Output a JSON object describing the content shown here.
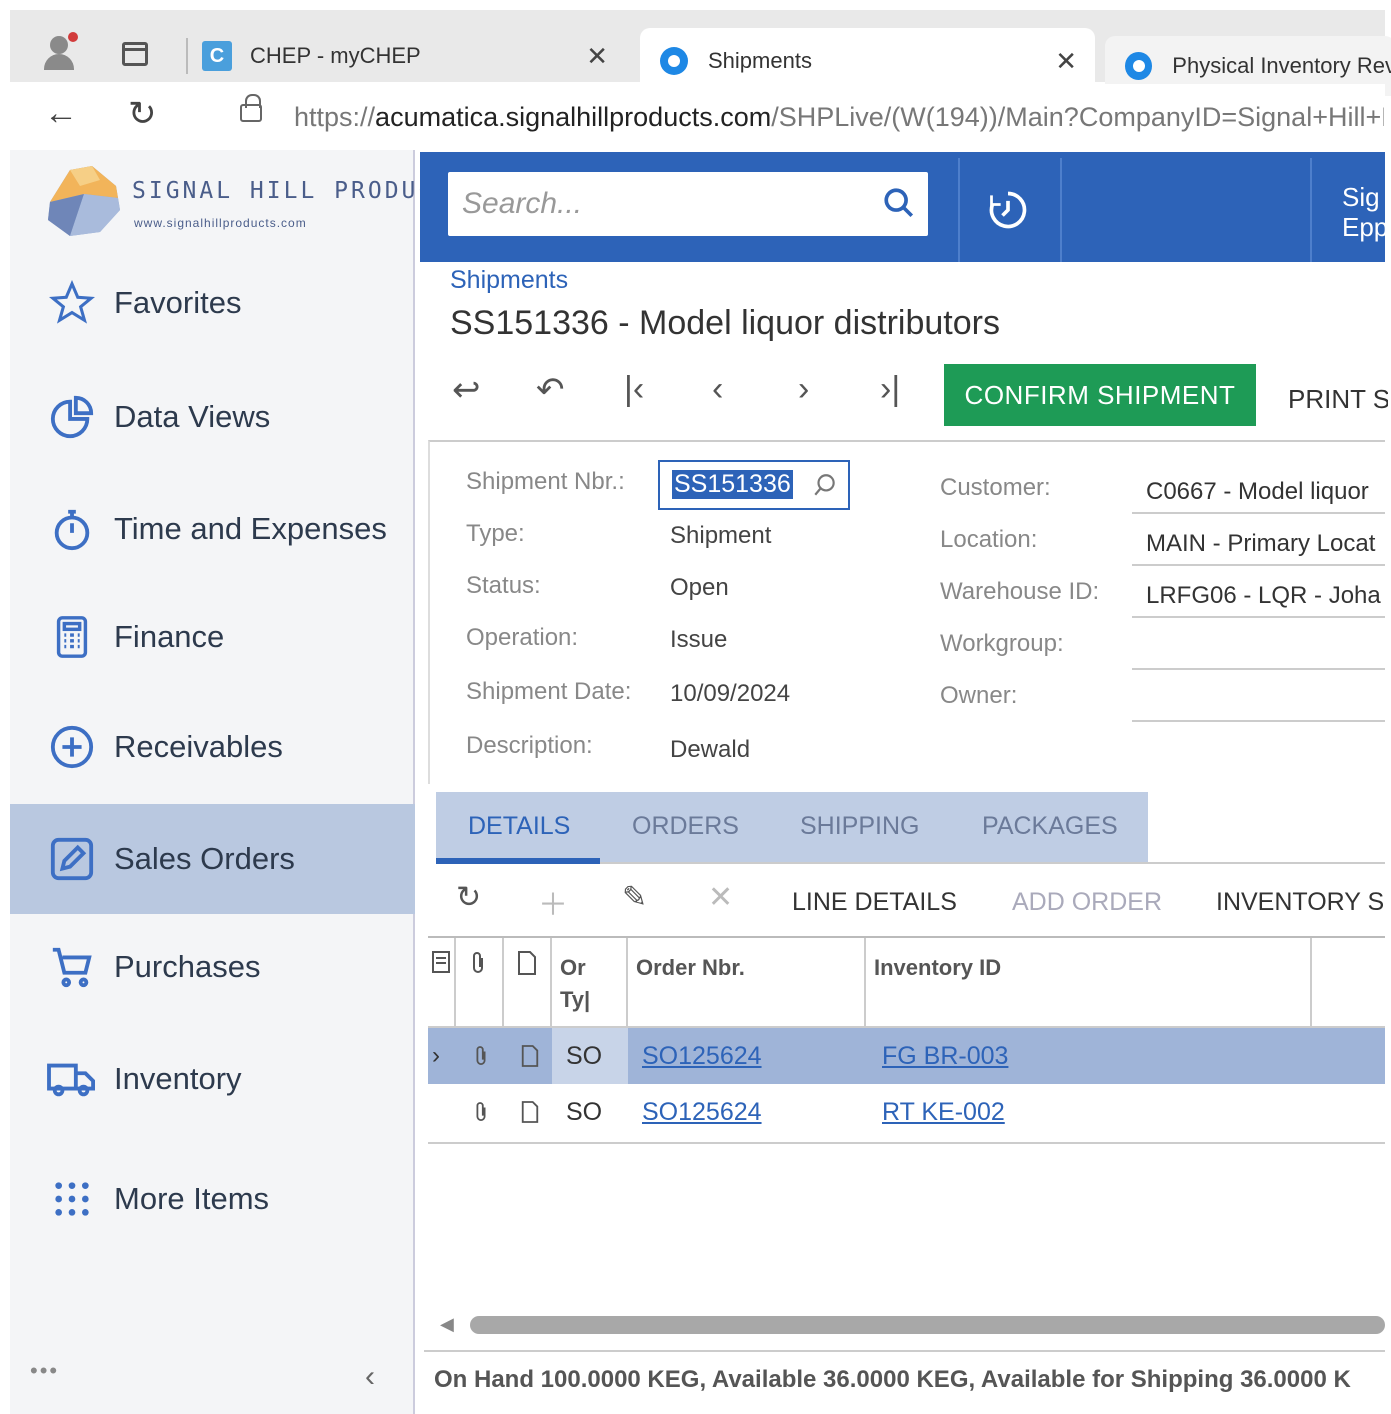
{
  "browser": {
    "tabs": [
      {
        "title": "CHEP - myCHEP"
      },
      {
        "title": "Shipments"
      },
      {
        "title": "Physical Inventory Revi"
      }
    ],
    "url_host": "https://",
    "url_domain": "acumatica.signalhillproducts.com",
    "url_path": "/SHPLive/(W(194))/Main?CompanyID=Signal+Hill+P"
  },
  "brand": {
    "name": "SIGNAL HILL PRODUCTS",
    "url": "www.signalhillproducts.com"
  },
  "sidebar": {
    "items": [
      {
        "label": "Favorites",
        "icon": "star-icon"
      },
      {
        "label": "Data Views",
        "icon": "pie-chart-icon"
      },
      {
        "label": "Time and Expenses",
        "icon": "stopwatch-icon"
      },
      {
        "label": "Finance",
        "icon": "calculator-icon"
      },
      {
        "label": "Receivables",
        "icon": "plus-circle-icon"
      },
      {
        "label": "Sales Orders",
        "icon": "edit-icon"
      },
      {
        "label": "Purchases",
        "icon": "cart-icon"
      },
      {
        "label": "Inventory",
        "icon": "truck-icon"
      },
      {
        "label": "More Items",
        "icon": "grid-dots-icon"
      }
    ],
    "more": "•••",
    "collapse": "‹"
  },
  "appbar": {
    "search_placeholder": "Search...",
    "user_line1": "Sig",
    "user_line2": "Epp"
  },
  "form": {
    "breadcrumb": "Shipments",
    "title": "SS151336 - Model liquor distributors",
    "confirm_label": "CONFIRM SHIPMENT",
    "print_label": "PRINT S",
    "labels": {
      "shipment_nbr": "Shipment Nbr.:",
      "type": "Type:",
      "status": "Status:",
      "operation": "Operation:",
      "shipment_date": "Shipment Date:",
      "description": "Description:",
      "customer": "Customer:",
      "location": "Location:",
      "warehouse": "Warehouse ID:",
      "workgroup": "Workgroup:",
      "owner": "Owner:"
    },
    "values": {
      "shipment_nbr": "SS151336",
      "type": "Shipment",
      "status": "Open",
      "operation": "Issue",
      "shipment_date": "10/09/2024",
      "description": "Dewald",
      "customer": "C0667 - Model liquor",
      "location": "MAIN - Primary Locat",
      "warehouse": "LRFG06 - LQR - Joha",
      "workgroup": "",
      "owner": ""
    }
  },
  "tabs": [
    "DETAILS",
    "ORDERS",
    "SHIPPING",
    "PACKAGES"
  ],
  "grid_toolbar": {
    "line_details": "LINE DETAILS",
    "add_order": "ADD ORDER",
    "inventory": "INVENTORY S"
  },
  "grid": {
    "headers": {
      "order_type": "Or Ty|",
      "order_nbr": "Order Nbr.",
      "inventory_id": "Inventory ID"
    },
    "rows": [
      {
        "type": "SO",
        "order_nbr": "SO125624",
        "inventory_id": "FG BR-003"
      },
      {
        "type": "SO",
        "order_nbr": "SO125624",
        "inventory_id": "RT KE-002"
      }
    ]
  },
  "status_text": "On Hand 100.0000 KEG, Available 36.0000 KEG, Available for Shipping 36.0000 K"
}
